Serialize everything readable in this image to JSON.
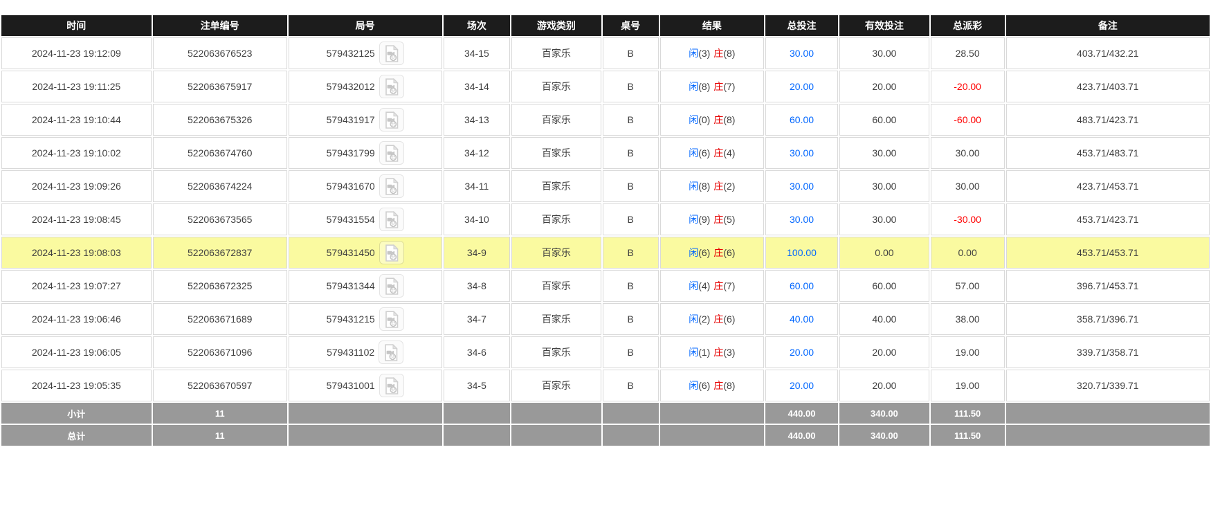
{
  "table": {
    "columns": [
      {
        "key": "time",
        "label": "时间"
      },
      {
        "key": "bet_id",
        "label": "注单编号"
      },
      {
        "key": "round_id",
        "label": "局号"
      },
      {
        "key": "session",
        "label": "场次"
      },
      {
        "key": "game",
        "label": "游戏类别"
      },
      {
        "key": "table_no",
        "label": "桌号"
      },
      {
        "key": "result",
        "label": "结果"
      },
      {
        "key": "total_bet",
        "label": "总投注"
      },
      {
        "key": "valid_bet",
        "label": "有效投注"
      },
      {
        "key": "payout",
        "label": "总派彩"
      },
      {
        "key": "remark",
        "label": "备注"
      }
    ],
    "result_labels": {
      "player": "闲",
      "banker": "庄"
    },
    "icons": {
      "round_video": "video-file-icon"
    },
    "colors": {
      "header_bg": "#1c1c1c",
      "highlight_row_bg": "#fafaa0",
      "footer_bg": "#999999",
      "link_blue": "#0066ff",
      "negative_red": "#ff0000",
      "banker_red": "#e60000"
    },
    "rows": [
      {
        "time": "2024-11-23 19:12:09",
        "bet_id": "522063676523",
        "round_id": "579432125",
        "session": "34-15",
        "game": "百家乐",
        "table_no": "B",
        "player": "3",
        "banker": "8",
        "total_bet": "30.00",
        "valid_bet": "30.00",
        "payout": "28.50",
        "remark": "403.71/432.21",
        "highlight": false
      },
      {
        "time": "2024-11-23 19:11:25",
        "bet_id": "522063675917",
        "round_id": "579432012",
        "session": "34-14",
        "game": "百家乐",
        "table_no": "B",
        "player": "8",
        "banker": "7",
        "total_bet": "20.00",
        "valid_bet": "20.00",
        "payout": "-20.00",
        "remark": "423.71/403.71",
        "highlight": false
      },
      {
        "time": "2024-11-23 19:10:44",
        "bet_id": "522063675326",
        "round_id": "579431917",
        "session": "34-13",
        "game": "百家乐",
        "table_no": "B",
        "player": "0",
        "banker": "8",
        "total_bet": "60.00",
        "valid_bet": "60.00",
        "payout": "-60.00",
        "remark": "483.71/423.71",
        "highlight": false
      },
      {
        "time": "2024-11-23 19:10:02",
        "bet_id": "522063674760",
        "round_id": "579431799",
        "session": "34-12",
        "game": "百家乐",
        "table_no": "B",
        "player": "6",
        "banker": "4",
        "total_bet": "30.00",
        "valid_bet": "30.00",
        "payout": "30.00",
        "remark": "453.71/483.71",
        "highlight": false
      },
      {
        "time": "2024-11-23 19:09:26",
        "bet_id": "522063674224",
        "round_id": "579431670",
        "session": "34-11",
        "game": "百家乐",
        "table_no": "B",
        "player": "8",
        "banker": "2",
        "total_bet": "30.00",
        "valid_bet": "30.00",
        "payout": "30.00",
        "remark": "423.71/453.71",
        "highlight": false
      },
      {
        "time": "2024-11-23 19:08:45",
        "bet_id": "522063673565",
        "round_id": "579431554",
        "session": "34-10",
        "game": "百家乐",
        "table_no": "B",
        "player": "9",
        "banker": "5",
        "total_bet": "30.00",
        "valid_bet": "30.00",
        "payout": "-30.00",
        "remark": "453.71/423.71",
        "highlight": false
      },
      {
        "time": "2024-11-23 19:08:03",
        "bet_id": "522063672837",
        "round_id": "579431450",
        "session": "34-9",
        "game": "百家乐",
        "table_no": "B",
        "player": "6",
        "banker": "6",
        "total_bet": "100.00",
        "valid_bet": "0.00",
        "payout": "0.00",
        "remark": "453.71/453.71",
        "highlight": true
      },
      {
        "time": "2024-11-23 19:07:27",
        "bet_id": "522063672325",
        "round_id": "579431344",
        "session": "34-8",
        "game": "百家乐",
        "table_no": "B",
        "player": "4",
        "banker": "7",
        "total_bet": "60.00",
        "valid_bet": "60.00",
        "payout": "57.00",
        "remark": "396.71/453.71",
        "highlight": false
      },
      {
        "time": "2024-11-23 19:06:46",
        "bet_id": "522063671689",
        "round_id": "579431215",
        "session": "34-7",
        "game": "百家乐",
        "table_no": "B",
        "player": "2",
        "banker": "6",
        "total_bet": "40.00",
        "valid_bet": "40.00",
        "payout": "38.00",
        "remark": "358.71/396.71",
        "highlight": false
      },
      {
        "time": "2024-11-23 19:06:05",
        "bet_id": "522063671096",
        "round_id": "579431102",
        "session": "34-6",
        "game": "百家乐",
        "table_no": "B",
        "player": "1",
        "banker": "3",
        "total_bet": "20.00",
        "valid_bet": "20.00",
        "payout": "19.00",
        "remark": "339.71/358.71",
        "highlight": false
      },
      {
        "time": "2024-11-23 19:05:35",
        "bet_id": "522063670597",
        "round_id": "579431001",
        "session": "34-5",
        "game": "百家乐",
        "table_no": "B",
        "player": "6",
        "banker": "8",
        "total_bet": "20.00",
        "valid_bet": "20.00",
        "payout": "19.00",
        "remark": "320.71/339.71",
        "highlight": false
      }
    ],
    "footer": [
      {
        "label": "小计",
        "count": "11",
        "total_bet": "440.00",
        "valid_bet": "340.00",
        "payout": "111.50"
      },
      {
        "label": "总计",
        "count": "11",
        "total_bet": "440.00",
        "valid_bet": "340.00",
        "payout": "111.50"
      }
    ]
  }
}
